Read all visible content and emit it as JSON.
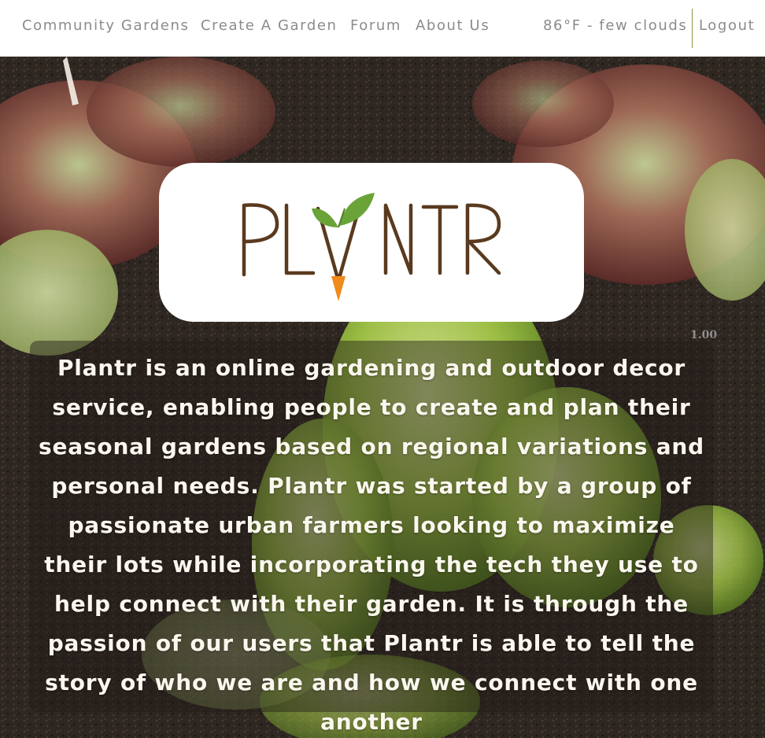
{
  "nav": {
    "links": [
      {
        "label": "Community Gardens"
      },
      {
        "label": "Create A Garden"
      },
      {
        "label": "Forum"
      },
      {
        "label": "About Us"
      }
    ],
    "weather": "86°F - few clouds",
    "logout_label": "Logout"
  },
  "logo": {
    "text": "PLANTR"
  },
  "about": {
    "text": "Plantr is an online gardening and outdoor decor service, enabling people to create and plan their seasonal gardens based on regional variations and personal needs. Plantr was started by a group of passionate urban farmers looking to maximize their lots while incorporating the tech they use to help connect with their garden. It is through the passion of our users that Plantr is able to tell the story of who we are and how we connect with one another"
  },
  "overlay_badge": "1.00",
  "colors": {
    "nav_text": "#8b8b8b",
    "divider": "#8a9a45",
    "logo_brown": "#5a3a1e",
    "logo_leaf": "#6aa338",
    "logo_carrot": "#f08a1c"
  }
}
